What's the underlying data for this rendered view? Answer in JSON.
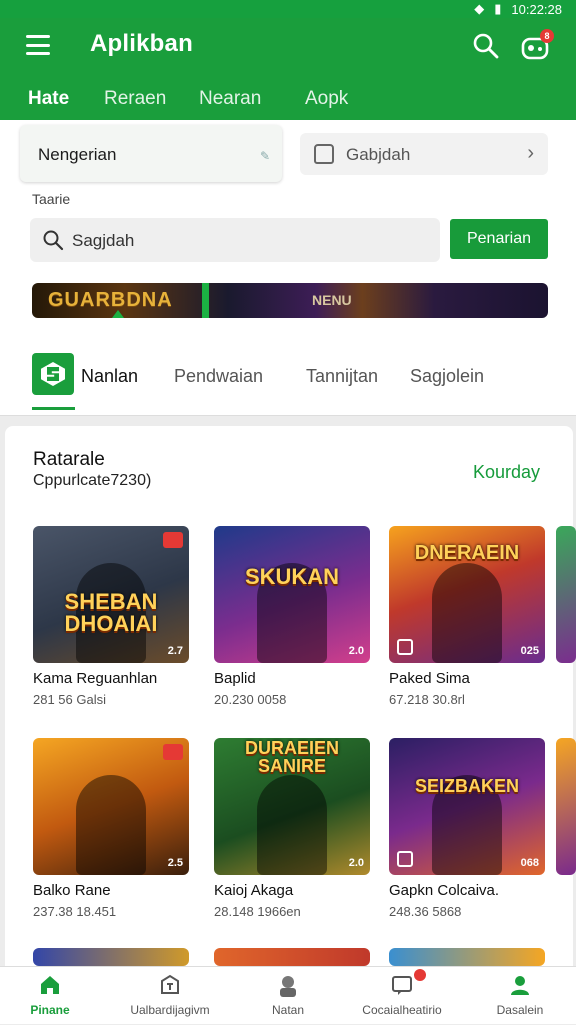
{
  "status": {
    "time": "10:22:28"
  },
  "appbar": {
    "title": "Aplikban",
    "notif_count": "8"
  },
  "tabs": [
    "Hate",
    "Reraen",
    "Nearan",
    "Aopk"
  ],
  "filters": {
    "left_value": "Nengerian",
    "right_value": "Gabjdah",
    "small_label": "Taarie"
  },
  "search": {
    "placeholder": "Sagjdah",
    "button": "Penarian"
  },
  "banner": {
    "left_text": "GUARBDNA",
    "right_text": "NENU"
  },
  "categories": [
    "Nanlan",
    "Pendwaian",
    "Tannijtan",
    "Sagjolein"
  ],
  "section": {
    "title": "Ratarale",
    "subtitle": "Cppurlcate7230)",
    "link": "Kourday"
  },
  "games": [
    {
      "title_art": "SHEBAN DHOAIAI",
      "name": "Kama Reguanhlan",
      "stats": "281 56   Galsi",
      "meta": "2.7"
    },
    {
      "title_art": "SKUKAN",
      "name": "Baplid",
      "stats": "20.230   0058",
      "meta": "2.0"
    },
    {
      "title_art": "DNERAEIN",
      "name": "Paked Sima",
      "stats": "67.218   30.8rl",
      "meta": "025"
    },
    {
      "title_art": "",
      "name": "Balko Rane",
      "stats": "237.38   18.451",
      "meta": "2.5"
    },
    {
      "title_art": "DURAEIEN SANIRE",
      "name": "Kaioj Akaga",
      "stats": "28.148   1966en",
      "meta": "2.0"
    },
    {
      "title_art": "SEIZBAKEN",
      "name": "Gapkn Colcaiva.",
      "stats": "248.36   5868",
      "meta": "068"
    }
  ],
  "bottom_nav": [
    "Pinane",
    "Ualbardijagivm",
    "Natan",
    "Cocaialheatirio",
    "Dasalein"
  ]
}
